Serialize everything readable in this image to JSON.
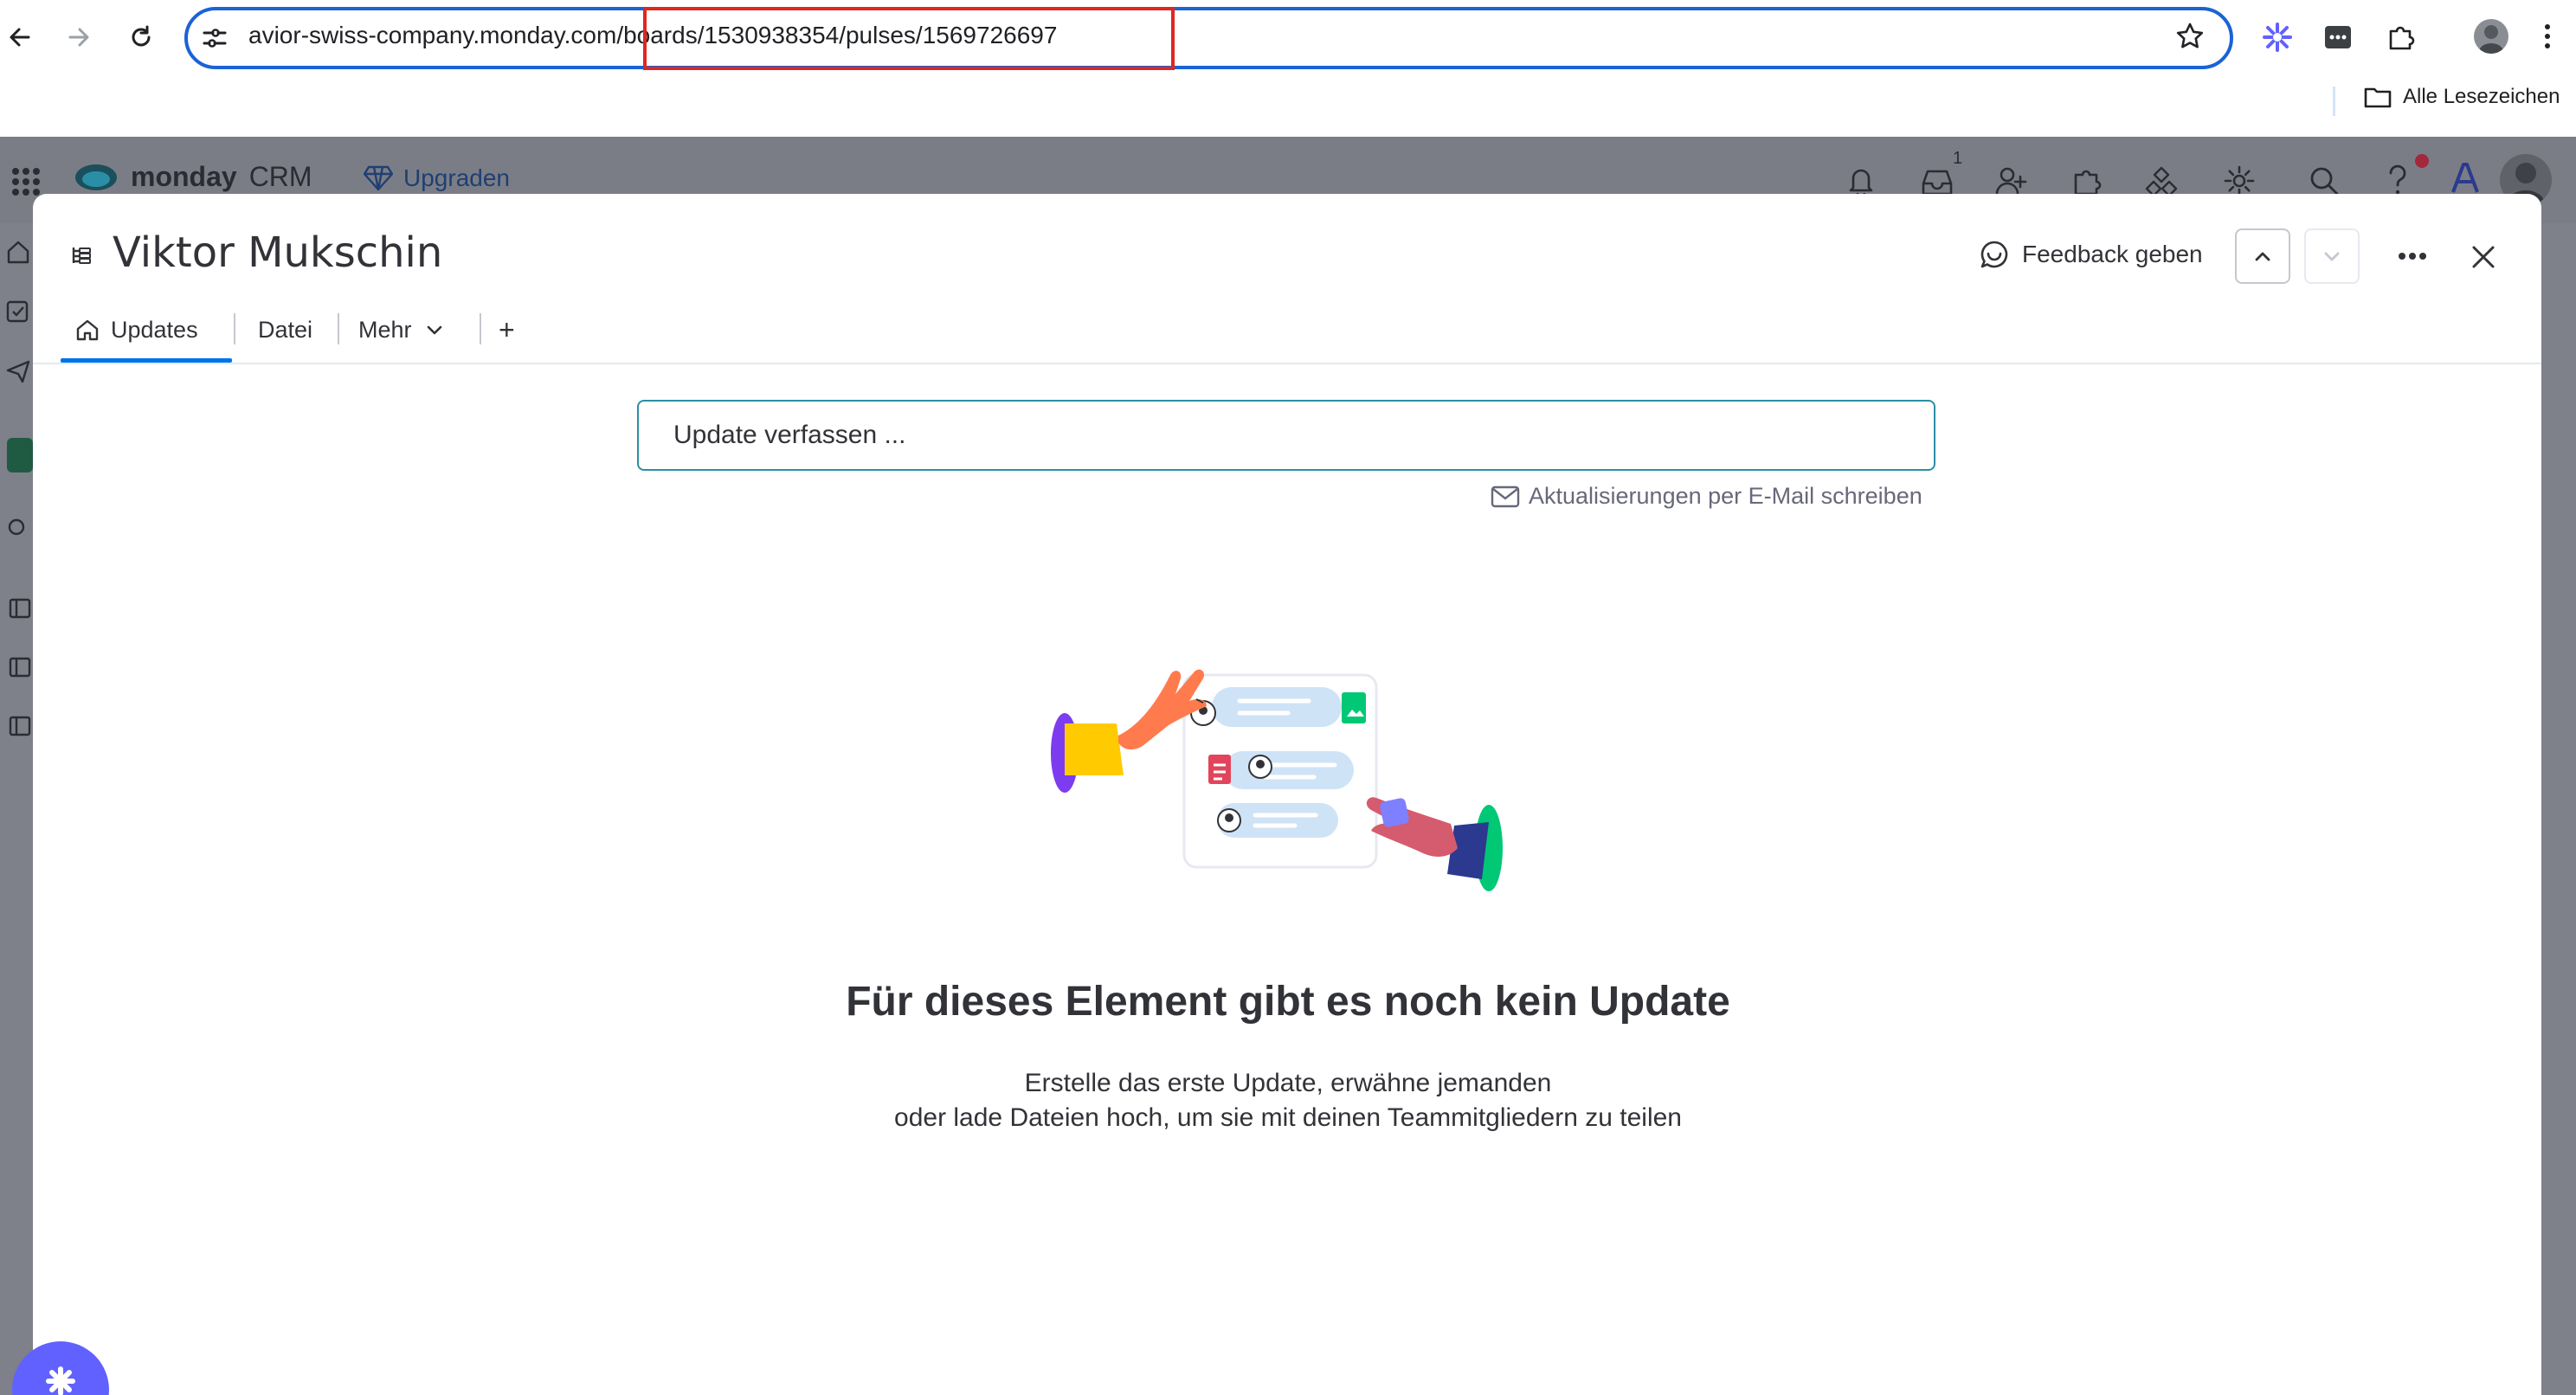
{
  "browser": {
    "url_host": "avior-swiss-company.monday.com",
    "url_path": "/boards/1530938354/pulses/1569726697",
    "bookmarks_label": "Alle Lesezeichen",
    "inbox_badge": "1"
  },
  "app": {
    "logo_text": "monday",
    "logo_sub": "CRM",
    "upgrade_label": "Upgraden"
  },
  "modal": {
    "title": "Viktor Mukschin",
    "feedback_label": "Feedback geben",
    "tabs": [
      {
        "label": "Updates"
      },
      {
        "label": "Datei"
      },
      {
        "label": "Mehr"
      }
    ],
    "add_tab_label": "+",
    "update_placeholder": "Update verfassen ...",
    "email_link_label": "Aktualisierungen per E-Mail schreiben",
    "empty_title": "Für dieses Element gibt es noch kein Update",
    "empty_desc_line1": "Erstelle das erste Update, erwähne jemanden",
    "empty_desc_line2": "oder lade Dateien hoch, um sie mit deinen Teammitgliedern zu teilen"
  },
  "colors": {
    "omnibox_border": "#1a63d6",
    "url_highlight": "#e0271f",
    "tab_active": "#0073ea",
    "input_border": "#2a8fa6",
    "assistant": "#6161ff"
  }
}
